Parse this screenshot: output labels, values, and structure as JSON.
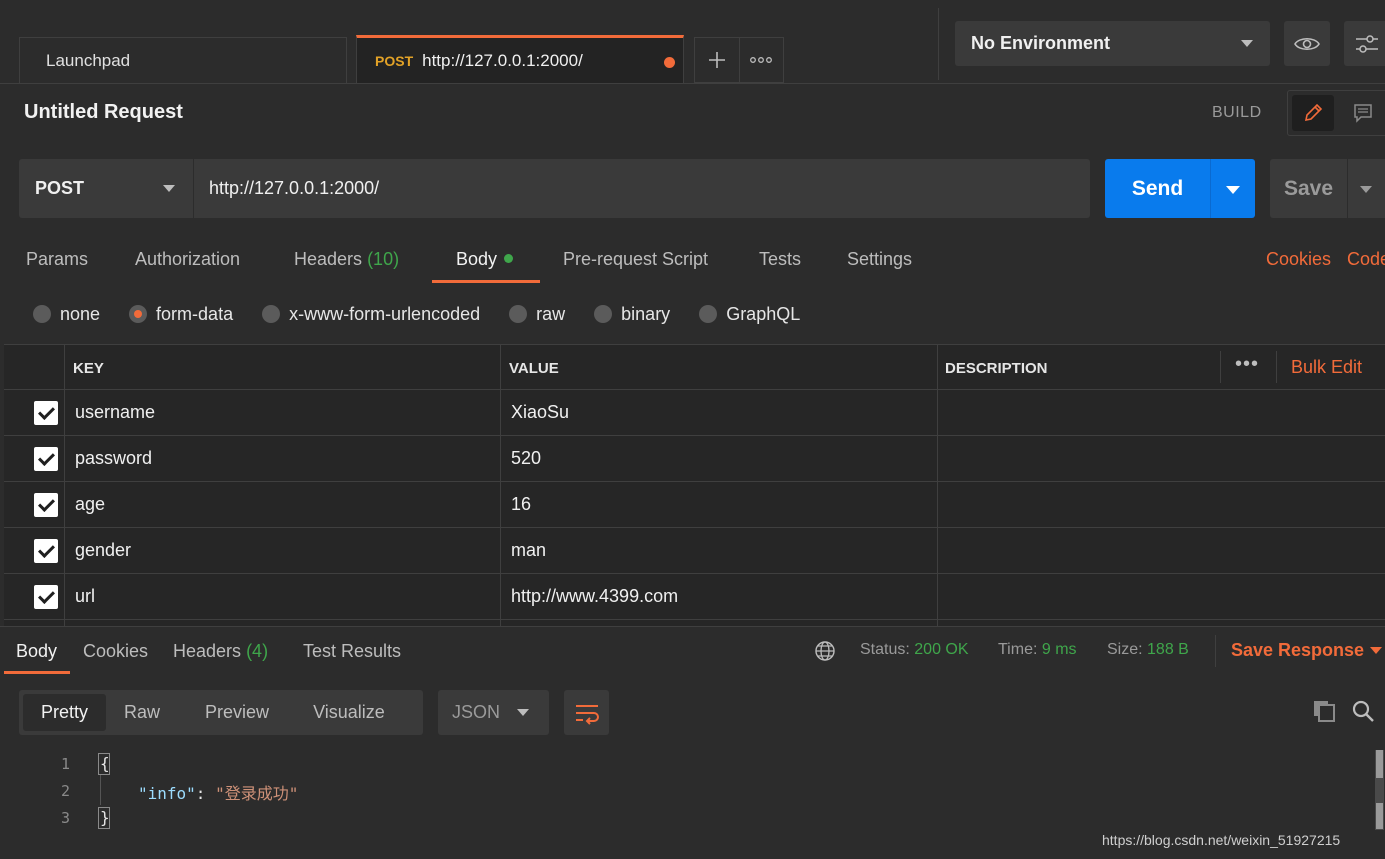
{
  "tabs": {
    "launchpad": "Launchpad",
    "active": {
      "method": "POST",
      "url": "http://127.0.0.1:2000/"
    },
    "new_tab_icon": "plus-icon",
    "more_icon": "ellipsis-icon"
  },
  "environment": {
    "selected": "No Environment"
  },
  "request": {
    "title": "Untitled Request",
    "mode_label": "BUILD",
    "method": "POST",
    "url": "http://127.0.0.1:2000/",
    "send_label": "Send",
    "save_label": "Save"
  },
  "request_tabs": {
    "params": "Params",
    "authorization": "Authorization",
    "headers": "Headers",
    "headers_count": "(10)",
    "body": "Body",
    "prerequest": "Pre-request Script",
    "tests": "Tests",
    "settings": "Settings",
    "cookies": "Cookies",
    "code": "Code"
  },
  "body_types": {
    "none": "none",
    "form_data": "form-data",
    "urlencoded": "x-www-form-urlencoded",
    "raw": "raw",
    "binary": "binary",
    "graphql": "GraphQL",
    "selected": "form-data"
  },
  "table": {
    "headers": {
      "key": "KEY",
      "value": "VALUE",
      "description": "DESCRIPTION"
    },
    "more": "•••",
    "bulk_edit": "Bulk Edit",
    "rows": [
      {
        "key": "username",
        "value": "XiaoSu",
        "checked": true
      },
      {
        "key": "password",
        "value": "520",
        "checked": true
      },
      {
        "key": "age",
        "value": "16",
        "checked": true
      },
      {
        "key": "gender",
        "value": "man",
        "checked": true
      },
      {
        "key": "url",
        "value": "http://www.4399.com",
        "checked": true
      }
    ]
  },
  "response": {
    "tabs": {
      "body": "Body",
      "cookies": "Cookies",
      "headers": "Headers",
      "headers_count": "(4)",
      "test_results": "Test Results"
    },
    "status_label": "Status:",
    "status_value": "200 OK",
    "time_label": "Time:",
    "time_value": "9 ms",
    "size_label": "Size:",
    "size_value": "188 B",
    "save_response": "Save Response",
    "views": {
      "pretty": "Pretty",
      "raw": "Raw",
      "preview": "Preview",
      "visualize": "Visualize"
    },
    "format": "JSON",
    "code": {
      "line_numbers": [
        "1",
        "2",
        "3"
      ],
      "open_brace": "{",
      "key": "\"info\"",
      "colon": ": ",
      "value": "\"登录成功\"",
      "close_brace": "}"
    }
  },
  "watermark": "https://blog.csdn.net/weixin_51927215",
  "colors": {
    "accent": "#f26b3a",
    "send_blue": "#097bed",
    "success_green": "#3fa64b",
    "method_yellow": "#e2a227"
  }
}
